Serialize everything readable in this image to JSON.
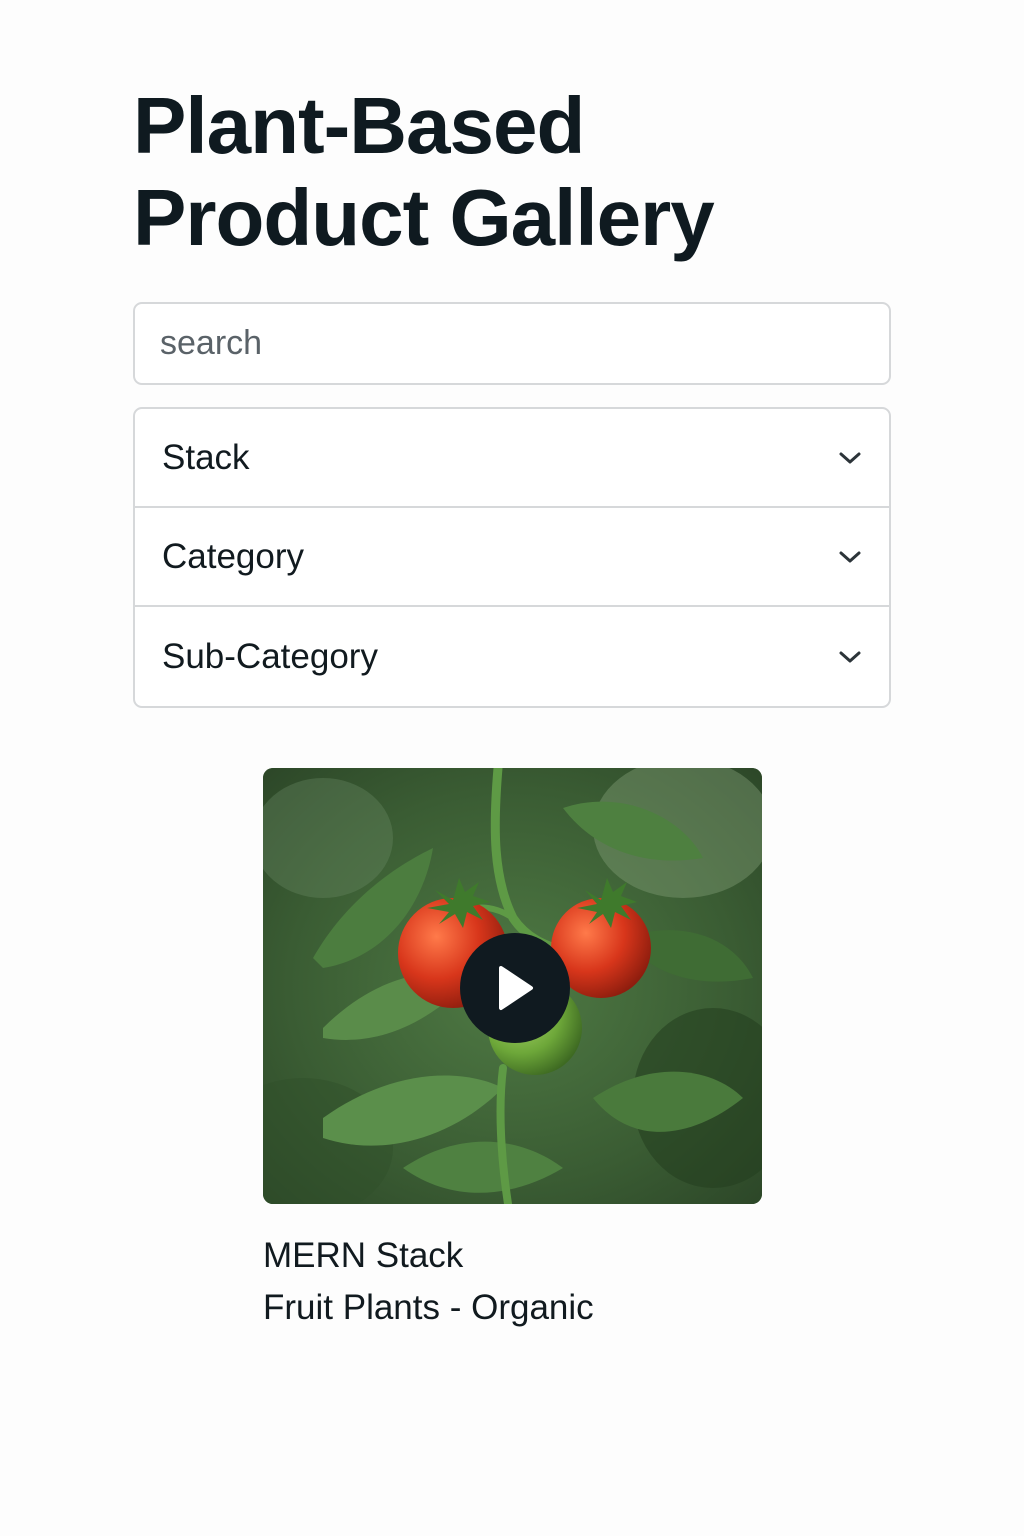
{
  "header": {
    "title": "Plant-Based Product Gallery"
  },
  "search": {
    "placeholder": "search",
    "value": ""
  },
  "filters": {
    "stack_label": "Stack",
    "category_label": "Category",
    "subcategory_label": "Sub-Category",
    "chevron_icon": "chevron-down-icon"
  },
  "product": {
    "title": "MERN Stack",
    "subtitle": "Fruit Plants - Organic",
    "thumbnail_subject": "tomato-plant",
    "play_icon": "play-icon"
  },
  "colors": {
    "text": "#0f1a20",
    "border": "#d6d8da",
    "play_button": "#101a20",
    "background": "#fdfdfd"
  }
}
